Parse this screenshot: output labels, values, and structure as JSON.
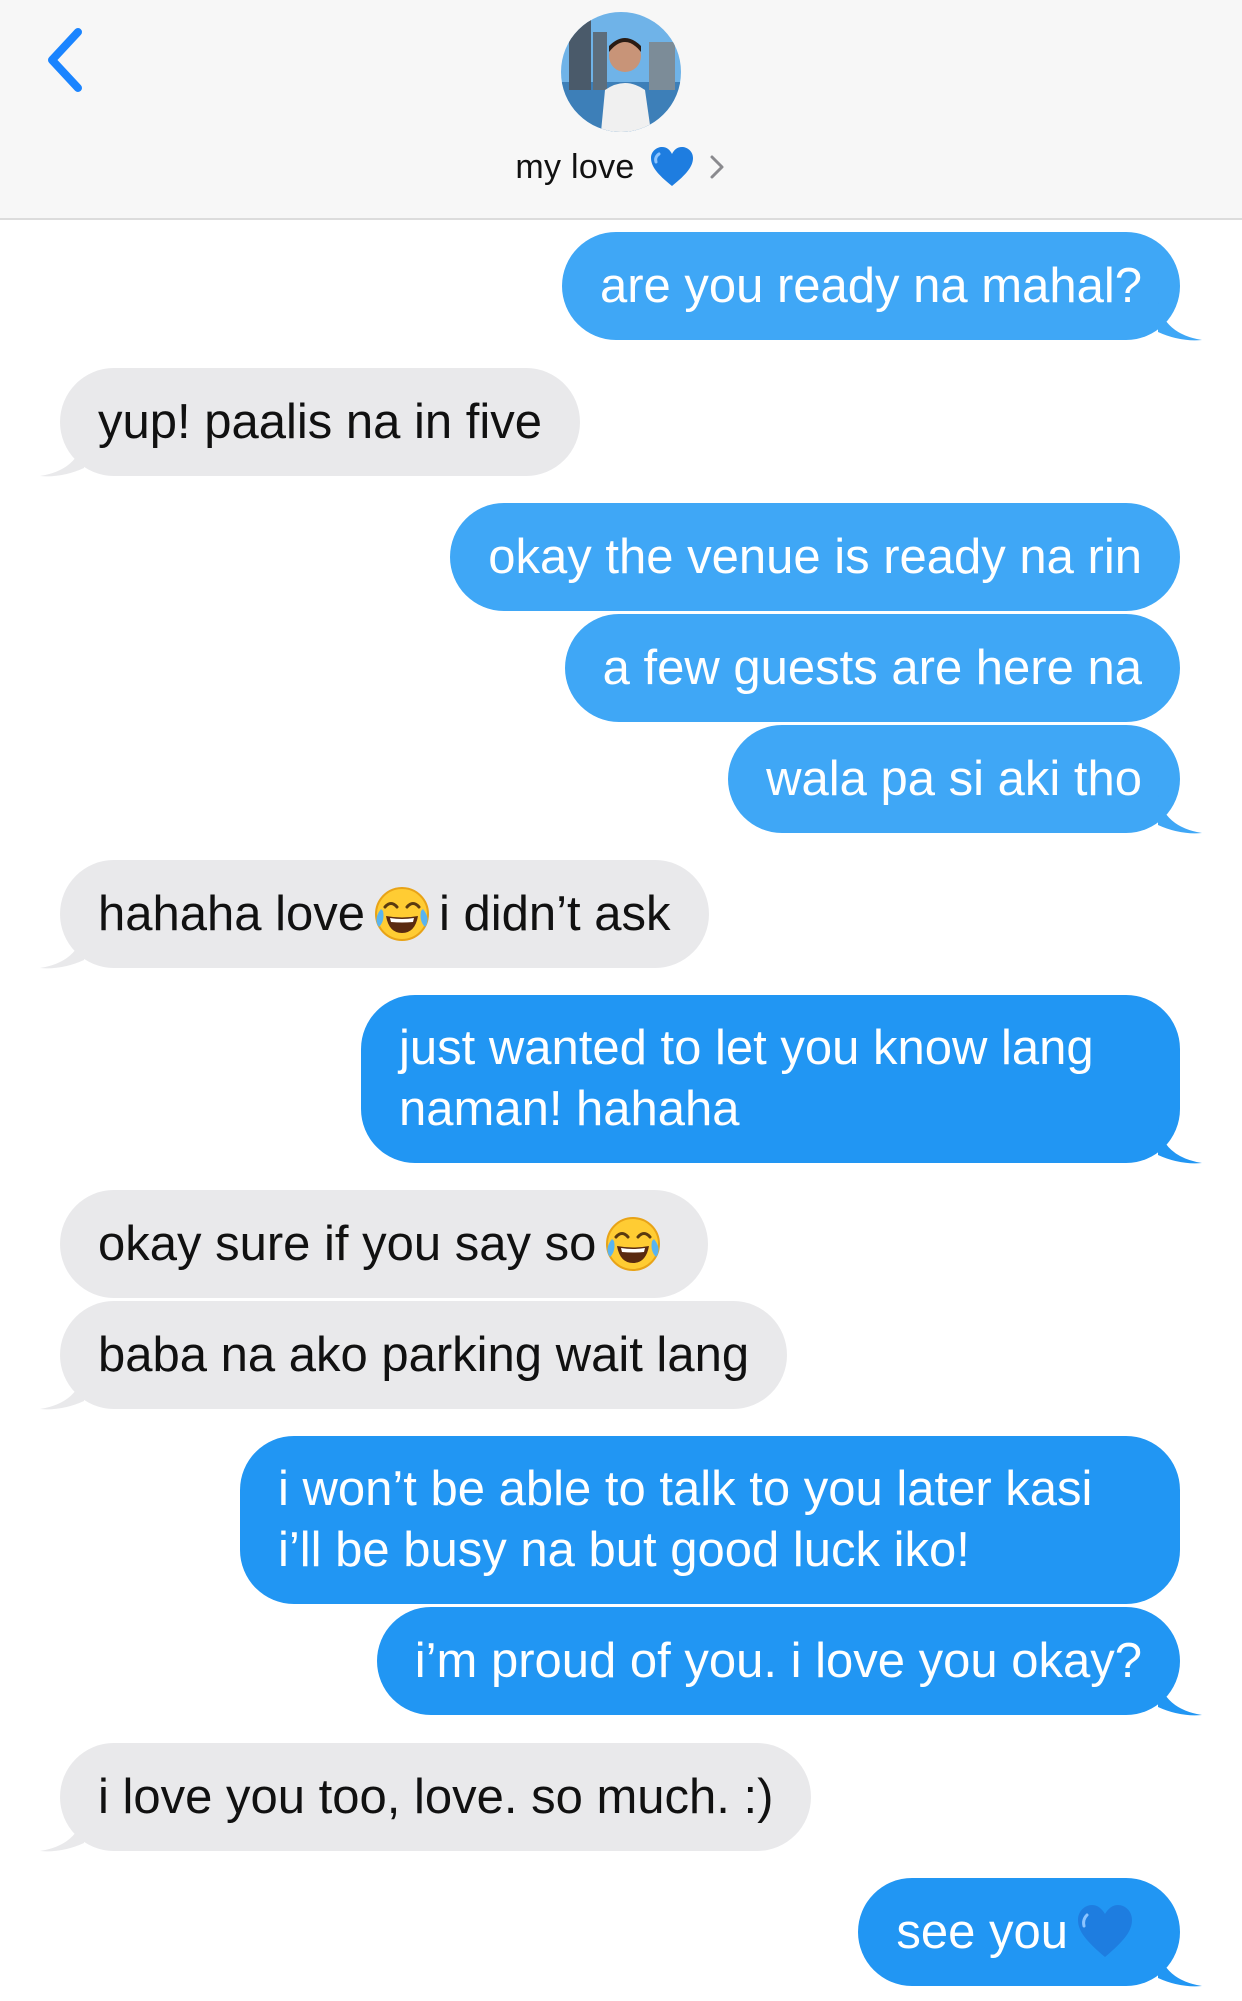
{
  "header": {
    "contact_name": "my love",
    "icons": {
      "back": "chevron-left-icon",
      "heart": "blue-heart-icon",
      "details": "chevron-right-icon"
    },
    "accent_color": "#1a84ff"
  },
  "colors": {
    "outgoing": "#2196f3",
    "outgoing_light": "#3fa7f6",
    "incoming": "#e9e9eb"
  },
  "messages": [
    {
      "from": "me",
      "text": "are you ready na mahal?"
    },
    {
      "from": "them",
      "text": "yup! paalis na in five"
    },
    {
      "from": "me",
      "text": "okay the venue is ready na rin"
    },
    {
      "from": "me",
      "text": "a few guests are here na"
    },
    {
      "from": "me",
      "text": "wala pa si aki tho"
    },
    {
      "from": "them",
      "text_before": "hahaha love",
      "emoji": "face-with-tears-of-joy-icon",
      "text_after": "i didn’t ask"
    },
    {
      "from": "me",
      "text": "just wanted to let you know lang naman! hahaha"
    },
    {
      "from": "them",
      "text_before": "okay sure if you say so",
      "emoji": "face-with-tears-of-joy-icon"
    },
    {
      "from": "them",
      "text": "baba na ako parking wait lang"
    },
    {
      "from": "me",
      "text": "i won’t be able to talk to you later kasi i’ll be busy na but good luck iko!"
    },
    {
      "from": "me",
      "text": "i’m proud of you. i love you okay?"
    },
    {
      "from": "them",
      "text": "i love you too, love. so much. :)"
    },
    {
      "from": "me",
      "text_before": "see you",
      "emoji": "blue-heart-icon"
    }
  ]
}
